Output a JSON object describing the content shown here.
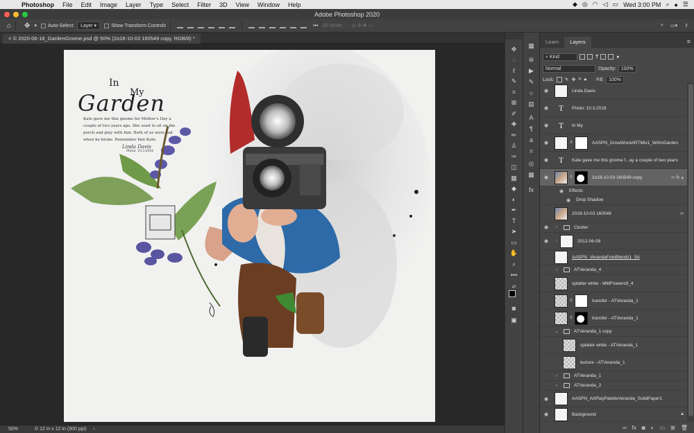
{
  "menubar": {
    "app": "Photoshop",
    "items": [
      "File",
      "Edit",
      "Image",
      "Layer",
      "Type",
      "Select",
      "Filter",
      "3D",
      "View",
      "Window",
      "Help"
    ],
    "clock": "Wed 3:00 PM"
  },
  "window": {
    "title": "Adobe Photoshop 2020"
  },
  "options": {
    "auto_select_label": "Auto-Select:",
    "auto_select_value": "Layer",
    "transform_label": "Show Transform Controls",
    "mode_3d": "3D Mode:"
  },
  "document": {
    "tab_label": "© 2020-06-18_GardenGnome.psd @ 50% (2o18-10-03 160549 copy, RGB/8) *",
    "journal_title_in": "In",
    "journal_title_my": "My",
    "journal_title_garden": "Garden",
    "journal_text": "Kate gave me this gnome for Mother's Day a couple of two years ago. She used to sit on the porch and play with him. Both of us were sad when he broke. Remember him Kate.",
    "signature": "Linda Davis",
    "photo_date": "Photo: 10.3.2018"
  },
  "status": {
    "zoom": "50%",
    "doc_info": "12 in x 12 in (300 ppi)"
  },
  "panel": {
    "tabs": [
      "Learn",
      "Layers"
    ],
    "filter_kind": "Kind",
    "blend_mode": "Normal",
    "opacity_label": "Opacity:",
    "opacity_value": "100%",
    "lock_label": "Lock:",
    "fill_label": "Fill:",
    "fill_value": "100%"
  },
  "layers": [
    {
      "name": "Linda Davis",
      "kind": "pixel",
      "thumb": "white"
    },
    {
      "name": "Photo: 10.3.2018",
      "kind": "text"
    },
    {
      "name": "In My",
      "kind": "text"
    },
    {
      "name": "AASPN_GrowWordARTMix1_WAInGarden",
      "kind": "masked"
    },
    {
      "name": "Kate gave me this gnome f...ay a couple of two years",
      "kind": "text"
    },
    {
      "name": "2o18-10-03 160549 copy",
      "kind": "selected"
    },
    {
      "name": "Effects",
      "kind": "effects"
    },
    {
      "name": "Drop Shadow",
      "kind": "effect-item"
    },
    {
      "name": "2018-10-03 160549",
      "kind": "photo"
    },
    {
      "name": "Cluster",
      "kind": "group"
    },
    {
      "name": "2012-06-08",
      "kind": "clipped"
    },
    {
      "name": "AASPN_VerandaFotoBlendz1_5A",
      "kind": "pixel-underline"
    },
    {
      "name": "ATVeranda_4",
      "kind": "group"
    },
    {
      "name": "splatter white - MMFlowers9_4",
      "kind": "checker"
    },
    {
      "name": "transfer - ATVeranda_1",
      "kind": "masked-checker"
    },
    {
      "name": "transfer - ATVeranda_1",
      "kind": "masked-dark"
    },
    {
      "name": "ATVeranda_1 copy",
      "kind": "group-open"
    },
    {
      "name": "splatter white - ATVeranda_1",
      "kind": "checker-indent"
    },
    {
      "name": "texture - ATVeranda_1",
      "kind": "checker-indent"
    },
    {
      "name": "ATVeranda_1",
      "kind": "group"
    },
    {
      "name": "ATVeranda_2",
      "kind": "group"
    },
    {
      "name": "AASPN_ArtPlayPaletteVeranda_SolidPaper1",
      "kind": "pixel"
    },
    {
      "name": "Background",
      "kind": "background"
    }
  ],
  "colors": {
    "ps_dark": "#282828",
    "panel": "#474747",
    "selected_row": "#636363"
  }
}
